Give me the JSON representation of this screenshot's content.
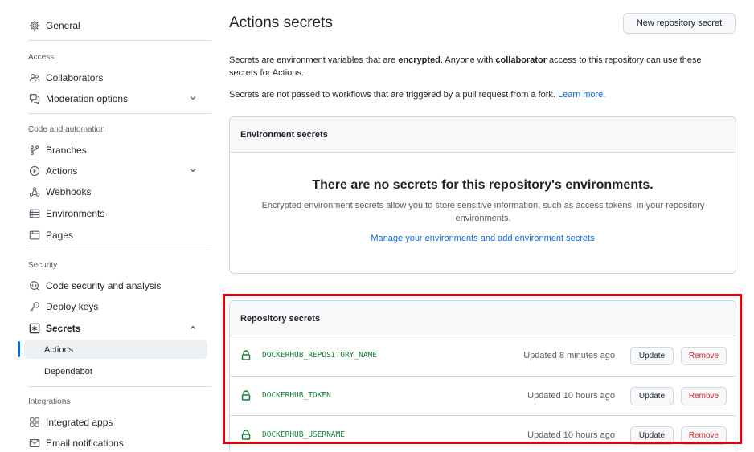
{
  "sidebar": {
    "general": "General",
    "access_heading": "Access",
    "collaborators": "Collaborators",
    "moderation": "Moderation options",
    "code_heading": "Code and automation",
    "branches": "Branches",
    "actions": "Actions",
    "webhooks": "Webhooks",
    "environments": "Environments",
    "pages": "Pages",
    "security_heading": "Security",
    "code_security": "Code security and analysis",
    "deploy_keys": "Deploy keys",
    "secrets": "Secrets",
    "secrets_actions": "Actions",
    "secrets_dependabot": "Dependabot",
    "integrations_heading": "Integrations",
    "integrated_apps": "Integrated apps",
    "email_notifications": "Email notifications"
  },
  "main": {
    "title": "Actions secrets",
    "new_secret_button": "New repository secret",
    "intro": {
      "part1": "Secrets are environment variables that are ",
      "encrypted": "encrypted",
      "part2": ". Anyone with ",
      "collaborator": "collaborator",
      "part3": " access to this repository can use these secrets for Actions."
    },
    "fork_note": "Secrets are not passed to workflows that are triggered by a pull request from a fork.",
    "learn_more": "Learn more.",
    "environment_secrets": {
      "heading": "Environment secrets",
      "empty_title": "There are no secrets for this repository's environments.",
      "empty_desc": "Encrypted environment secrets allow you to store sensitive information, such as access tokens, in your repository environments.",
      "manage_link": "Manage your environments and add environment secrets"
    },
    "repository_secrets": {
      "heading": "Repository secrets",
      "update_label": "Update",
      "remove_label": "Remove",
      "items": [
        {
          "name": "DOCKERHUB_REPOSITORY_NAME",
          "updated": "Updated 8 minutes ago"
        },
        {
          "name": "DOCKERHUB_TOKEN",
          "updated": "Updated 10 hours ago"
        },
        {
          "name": "DOCKERHUB_USERNAME",
          "updated": "Updated 10 hours ago"
        }
      ]
    }
  },
  "colors": {
    "accent": "#0969da",
    "secret_green": "#1a7f37",
    "danger": "#cf222e",
    "highlight": "#e0000c"
  }
}
